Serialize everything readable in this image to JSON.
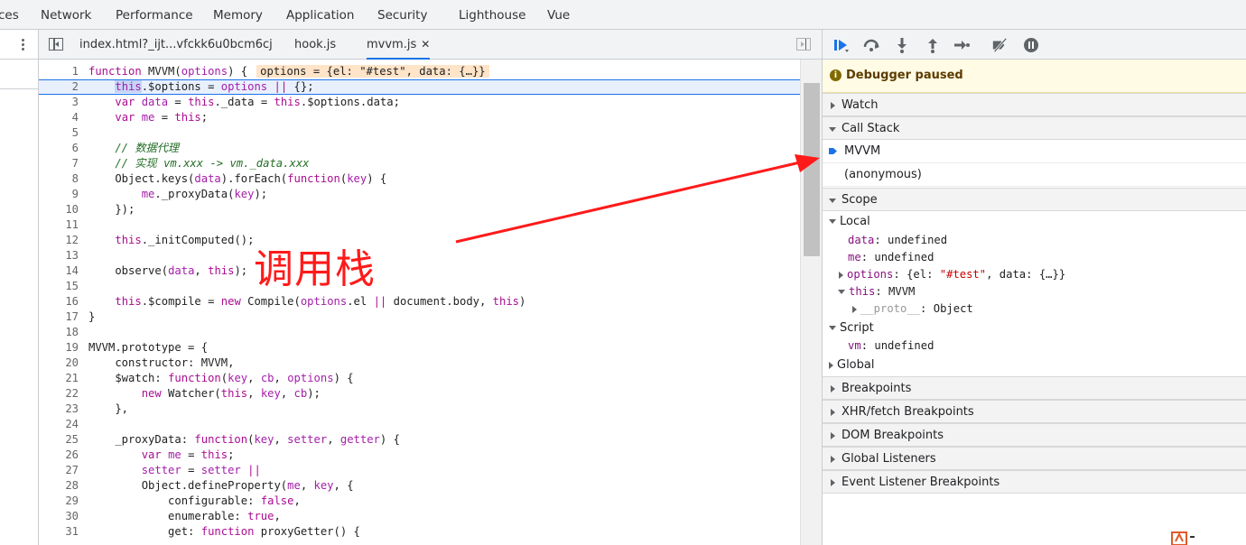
{
  "top_tabs": [
    "ces",
    "Network",
    "Performance",
    "Memory",
    "Application",
    "Security",
    "Lighthouse",
    "Vue"
  ],
  "file_tabs": {
    "items": [
      "index.html?_ijt...vfckk6u0bcm6cj",
      "hook.js",
      "mvvm.js"
    ],
    "close_glyph": "✕",
    "active_index": 2
  },
  "code": {
    "current_line": 2,
    "line_numbers": [
      "1",
      "2",
      "3",
      "4",
      "5",
      "6",
      "7",
      "8",
      "9",
      "10",
      "11",
      "12",
      "13",
      "14",
      "15",
      "16",
      "17",
      "18",
      "19",
      "20",
      "21",
      "22",
      "23",
      "24",
      "25",
      "26",
      "27",
      "28",
      "29",
      "30",
      "31"
    ],
    "inline_value_prefix": "options = ",
    "inline_value": "{el: \"#test\", data: {…}}",
    "lines": [
      "function MVVM(options) {",
      "    this.$options = options || {};",
      "    var data = this._data = this.$options.data;",
      "    var me = this;",
      "",
      "    // 数据代理",
      "    // 实现 vm.xxx -> vm._data.xxx",
      "    Object.keys(data).forEach(function(key) {",
      "        me._proxyData(key);",
      "    });",
      "",
      "    this._initComputed();",
      "",
      "    observe(data, this);",
      "",
      "    this.$compile = new Compile(options.el || document.body, this)",
      "}",
      "",
      "MVVM.prototype = {",
      "    constructor: MVVM,",
      "    $watch: function(key, cb, options) {",
      "        new Watcher(this, key, cb);",
      "    },",
      "",
      "    _proxyData: function(key, setter, getter) {",
      "        var me = this;",
      "        setter = setter ||",
      "        Object.defineProperty(me, key, {",
      "            configurable: false,",
      "            enumerable: true,",
      "            get: function proxyGetter() {"
    ]
  },
  "annotation": {
    "text": "调用栈",
    "color": "#ff1a1a"
  },
  "debugger": {
    "paused_message": "Debugger paused",
    "sections": {
      "watch": "Watch",
      "call_stack": "Call Stack",
      "scope": "Scope",
      "breakpoints": "Breakpoints",
      "xhr": "XHR/fetch Breakpoints",
      "dom": "DOM Breakpoints",
      "global_listeners": "Global Listeners",
      "event_listeners": "Event Listener Breakpoints"
    },
    "call_stack": [
      "MVVM",
      "(anonymous)"
    ],
    "scope": {
      "local_label": "Local",
      "data_key": "data",
      "data_val": "undefined",
      "me_key": "me",
      "me_val": "undefined",
      "options_key": "options",
      "options_val_pre": "{el: ",
      "options_val_str": "\"#test\"",
      "options_val_post": ", data: {…}}",
      "this_key": "this",
      "this_val": "MVVM",
      "proto_key": "__proto__",
      "proto_val": "Object",
      "script_label": "Script",
      "vm_key": "vm",
      "vm_val": "undefined",
      "global_label": "Global"
    }
  },
  "colors": {
    "accent": "#1a73e8",
    "paused_banner_bg": "#fffbe5",
    "current_line_bg": "#e8f0fe"
  }
}
